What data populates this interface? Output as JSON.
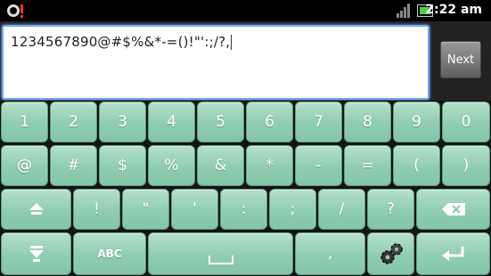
{
  "status_bar": {
    "time": "2:22 am",
    "icons": [
      "notification-icon",
      "signal-icon",
      "battery-icon"
    ]
  },
  "input": {
    "value": "1234567890@#$%&*-=()!\"':;/?,"
  },
  "next_button": {
    "label": "Next"
  },
  "keyboard": {
    "row1": [
      "1",
      "2",
      "3",
      "4",
      "5",
      "6",
      "7",
      "8",
      "9",
      "0"
    ],
    "row2": [
      "@",
      "#",
      "$",
      "%",
      "&",
      "*",
      "-",
      "=",
      "(",
      ")"
    ],
    "row3": [
      "!",
      "\"",
      "'",
      ":",
      ";",
      "/",
      "?"
    ],
    "row4": {
      "abc": "ABC",
      "comma": ","
    },
    "icons": [
      "shift-icon",
      "backspace-icon",
      "hide-keyboard-icon",
      "space-icon",
      "settings-icon",
      "enter-icon"
    ]
  },
  "colors": {
    "key_top": "#b5e0c9",
    "key_bottom": "#84c5a8",
    "field_border": "#6fa7ff"
  }
}
